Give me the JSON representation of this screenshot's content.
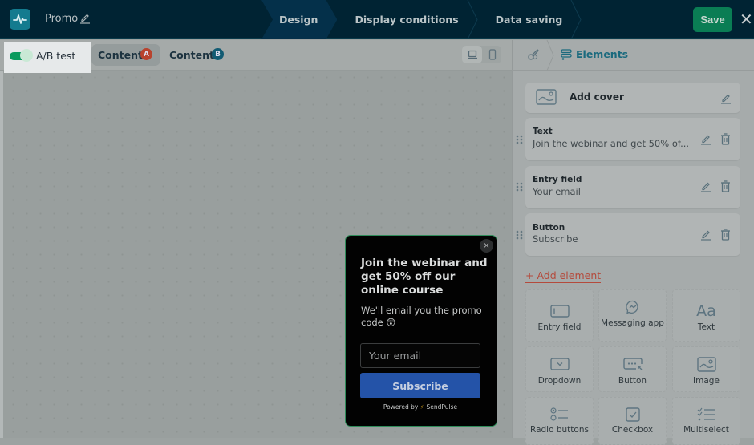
{
  "header": {
    "title": "Promo",
    "steps": [
      {
        "label": "Design",
        "active": true
      },
      {
        "label": "Display conditions",
        "active": false
      },
      {
        "label": "Data saving",
        "active": false
      }
    ],
    "save_label": "Save",
    "close_glyph": "✕"
  },
  "toolbar": {
    "ab_test_label": "A/B test",
    "ab_test_enabled": true,
    "content_tabs": [
      {
        "label": "Content",
        "badge": "A",
        "badge_color": "#b8432e",
        "active": true
      },
      {
        "label": "Content",
        "badge": "B",
        "badge_color": "#125b73",
        "active": false
      }
    ],
    "view_modes": [
      "desktop",
      "mobile"
    ],
    "selected_view": "desktop"
  },
  "popup": {
    "close_glyph": "×",
    "title": "Join the webinar and get 50% off our online course",
    "description": "We'll email you the promo code 😲",
    "email_placeholder": "Your email",
    "button_label": "Subscribe",
    "powered_prefix": "Powered by",
    "powered_bolt": "⚡",
    "powered_brand": "SendPulse"
  },
  "panel": {
    "tab_label": "Elements",
    "cover": {
      "label": "Add cover"
    },
    "elements": [
      {
        "title": "Text",
        "value": "Join the webinar and get 50% of..."
      },
      {
        "title": "Entry field",
        "value": "Your email"
      },
      {
        "title": "Button",
        "value": "Subscribe"
      }
    ],
    "add_element_label": "+ Add element",
    "element_types": [
      {
        "label": "Entry field",
        "icon": "entry-field-icon"
      },
      {
        "label": "Messaging app",
        "icon": "messaging-app-icon"
      },
      {
        "label": "Text",
        "icon": "text-icon",
        "glyph": "Aa"
      },
      {
        "label": "Dropdown",
        "icon": "dropdown-icon"
      },
      {
        "label": "Button",
        "icon": "button-icon"
      },
      {
        "label": "Image",
        "icon": "image-icon"
      },
      {
        "label": "Radio buttons",
        "icon": "radio-buttons-icon"
      },
      {
        "label": "Checkbox",
        "icon": "checkbox-icon"
      },
      {
        "label": "Multiselect",
        "icon": "multiselect-icon"
      }
    ]
  },
  "colors": {
    "header_bg": "#002333",
    "save_green": "#0a7d54",
    "accent_teal": "#1b6a7e",
    "add_element_red": "#b44a3c",
    "subscribe_blue": "#2453a8"
  }
}
